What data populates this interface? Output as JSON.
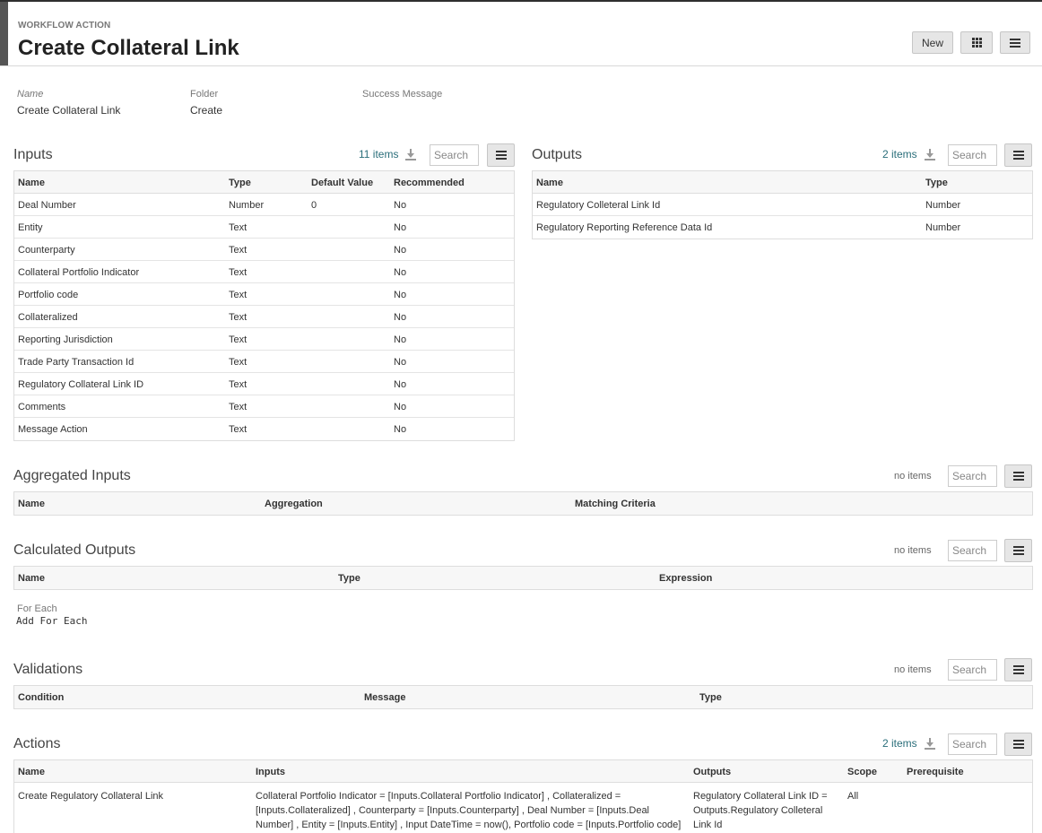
{
  "header": {
    "kicker": "WORKFLOW ACTION",
    "title": "Create Collateral Link",
    "new_label": "New"
  },
  "meta": {
    "name_label": "Name",
    "name_value": "Create Collateral Link",
    "folder_label": "Folder",
    "folder_value": "Create",
    "success_label": "Success Message"
  },
  "search_placeholder": "Search",
  "inputs": {
    "title": "Inputs",
    "count": "11 items",
    "columns": [
      "Name",
      "Type",
      "Default Value",
      "Recommended"
    ],
    "rows": [
      [
        "Deal Number",
        "Number",
        "0",
        "No"
      ],
      [
        "Entity",
        "Text",
        "",
        "No"
      ],
      [
        "Counterparty",
        "Text",
        "",
        "No"
      ],
      [
        "Collateral Portfolio Indicator",
        "Text",
        "",
        "No"
      ],
      [
        "Portfolio code",
        "Text",
        "",
        "No"
      ],
      [
        "Collateralized",
        "Text",
        "",
        "No"
      ],
      [
        "Reporting Jurisdiction",
        "Text",
        "",
        "No"
      ],
      [
        "Trade Party Transaction Id",
        "Text",
        "",
        "No"
      ],
      [
        "Regulatory Collateral Link ID",
        "Text",
        "",
        "No"
      ],
      [
        "Comments",
        "Text",
        "",
        "No"
      ],
      [
        "Message Action",
        "Text",
        "",
        "No"
      ]
    ]
  },
  "outputs": {
    "title": "Outputs",
    "count": "2 items",
    "columns": [
      "Name",
      "Type"
    ],
    "rows": [
      [
        "Regulatory Colleteral Link Id",
        "Number"
      ],
      [
        "Regulatory Reporting Reference Data Id",
        "Number"
      ]
    ]
  },
  "aggregated_inputs": {
    "title": "Aggregated Inputs",
    "count": "no items",
    "columns": [
      "Name",
      "Aggregation",
      "Matching Criteria"
    ]
  },
  "calculated_outputs": {
    "title": "Calculated Outputs",
    "count": "no items",
    "columns": [
      "Name",
      "Type",
      "Expression"
    ]
  },
  "for_each": {
    "label": "For Each",
    "link": "Add For Each"
  },
  "validations": {
    "title": "Validations",
    "count": "no items",
    "columns": [
      "Condition",
      "Message",
      "Type"
    ]
  },
  "actions": {
    "title": "Actions",
    "count": "2 items",
    "columns": [
      "Name",
      "Inputs",
      "Outputs",
      "Scope",
      "Prerequisite"
    ],
    "row": {
      "name": "Create Regulatory Collateral Link",
      "inputs_l1": "Collateral Portfolio Indicator = [Inputs.Collateral Portfolio Indicator] , Collateralized =",
      "inputs_l2": "[Inputs.Collateralized] , Counterparty = [Inputs.Counterparty] , Deal Number = [Inputs.Deal",
      "inputs_l3": "Number] , Entity = [Inputs.Entity] , Input DateTime = now(), Portfolio code = [Inputs.Portfolio code]",
      "outputs_l1": "Regulatory Collateral Link ID =",
      "outputs_l2": "Outputs.Regulatory Colleteral",
      "outputs_l3": "Link Id",
      "scope": "All",
      "prerequisite": ""
    }
  }
}
